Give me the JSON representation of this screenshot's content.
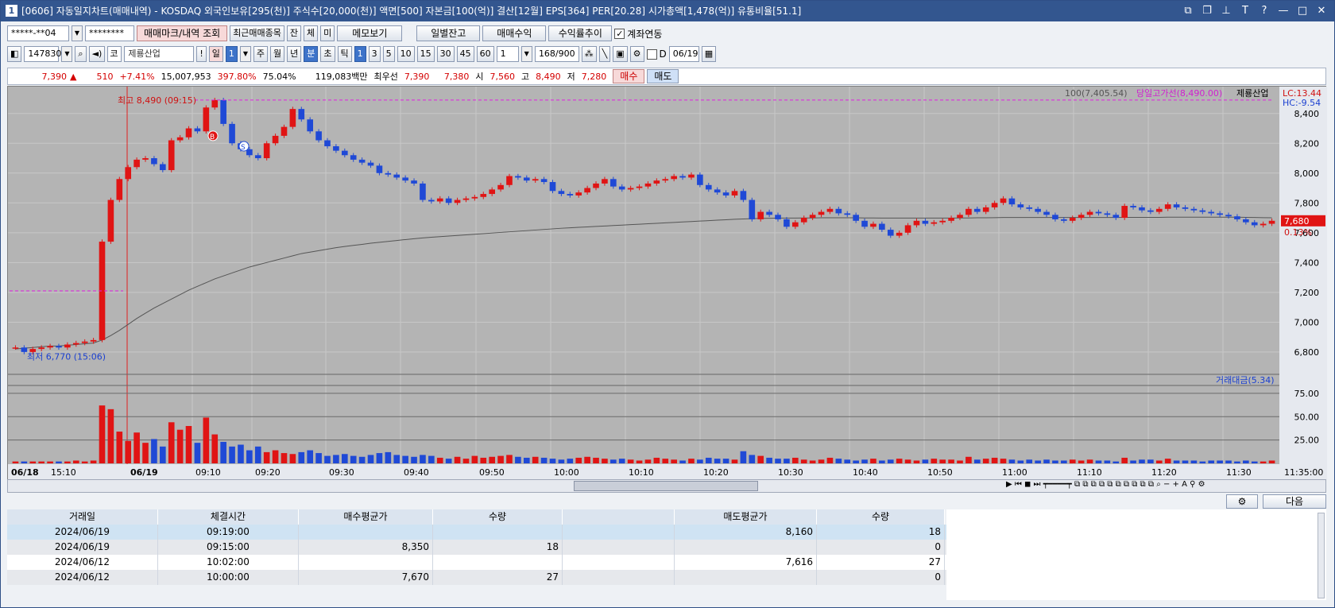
{
  "title": "[0606] 자동일지차트(매매내역) - KOSDAQ 외국인보유[295(천)] 주식수[20,000(천)] 액면[500] 자본금[100(억)] 결산[12월] EPS[364] PER[20.28] 시가총액[1,478(억)] 유통비율[51.1]",
  "window_num": "1",
  "toolbar1": {
    "account": "*****-**04",
    "password": "********",
    "btn_marks": "매매마크/내역 조회",
    "btn_recent": "최근매매종목",
    "btn_jan": "잔",
    "btn_che": "체",
    "btn_mi": "미",
    "btn_memo": "메모보기",
    "btn_daily": "일별잔고",
    "btn_profit": "매매수익",
    "btn_rate": "수익률추이",
    "link_label": "계좌연동"
  },
  "toolbar2": {
    "code": "147830",
    "market": "코",
    "name": "제룡산업",
    "ex": "!",
    "day": "일",
    "day_n": "1",
    "week": "주",
    "month": "월",
    "year": "년",
    "minute": "분",
    "sec": "초",
    "tick": "틱",
    "periods": [
      "1",
      "3",
      "5",
      "10",
      "15",
      "30",
      "45",
      "60"
    ],
    "count": "1",
    "range": "168/900",
    "d": "D",
    "date": "06/19"
  },
  "quote": {
    "price": "7,390",
    "arrow": "▲",
    "change": "510",
    "rate": "+7.41%",
    "volume": "15,007,953",
    "vol_rate": "397.80%",
    "turnover": "75.04%",
    "amount": "119,083백만",
    "best_label": "최우선",
    "ask": "7,390",
    "bid": "7,380",
    "open_l": "시",
    "open": "7,560",
    "high_l": "고",
    "high": "8,490",
    "low_l": "저",
    "low": "7,280",
    "buy": "매수",
    "sell": "매도"
  },
  "chart_data": {
    "type": "candlestick",
    "ylim": [
      6650,
      8580
    ],
    "yticks": [
      "8,400",
      "8,200",
      "8,000",
      "7,800",
      "7,600",
      "7,400",
      "7,200",
      "7,000",
      "6,800"
    ],
    "ytick_values": [
      8400,
      8200,
      8000,
      7800,
      7600,
      7400,
      7200,
      7000,
      6800
    ],
    "xlabels": [
      "06/18",
      "15:10",
      "06/19",
      "09:10",
      "09:20",
      "09:30",
      "09:40",
      "09:50",
      "10:00",
      "10:10",
      "10:20",
      "10:30",
      "10:40",
      "10:50",
      "11:00",
      "11:10",
      "11:20",
      "11:30",
      "11:35:00"
    ],
    "legend_ma": "100(7,405.54)",
    "legend_high": "당일고가선(8,490.00)",
    "legend_name": "제룡산업",
    "lc": "LC:13.44",
    "hc": "HC:-9.54",
    "last_price": "7,680",
    "last_rate": "0.13%",
    "high_note": "최고 8,490 (09:15)",
    "low_note": "최저 6,770 (15:06)",
    "mark_b": "B",
    "mark_s": "S",
    "close_series": [
      6830,
      6800,
      6820,
      6830,
      6840,
      6830,
      6850,
      6860,
      6870,
      6880,
      7540,
      7820,
      7960,
      8040,
      8090,
      8100,
      8060,
      8020,
      8220,
      8240,
      8300,
      8280,
      8440,
      8490,
      8330,
      8200,
      8160,
      8120,
      8100,
      8200,
      8250,
      8310,
      8430,
      8360,
      8280,
      8220,
      8180,
      8150,
      8120,
      8090,
      8070,
      8050,
      8000,
      7990,
      7970,
      7950,
      7930,
      7820,
      7810,
      7830,
      7800,
      7820,
      7830,
      7840,
      7860,
      7890,
      7920,
      7980,
      7970,
      7950,
      7960,
      7940,
      7880,
      7860,
      7850,
      7870,
      7900,
      7930,
      7960,
      7910,
      7890,
      7900,
      7910,
      7930,
      7950,
      7960,
      7980,
      7970,
      7990,
      7920,
      7890,
      7870,
      7850,
      7880,
      7820,
      7690,
      7740,
      7720,
      7690,
      7640,
      7670,
      7700,
      7720,
      7740,
      7760,
      7730,
      7720,
      7680,
      7640,
      7660,
      7620,
      7580,
      7600,
      7650,
      7680,
      7660,
      7670,
      7680,
      7700,
      7720,
      7760,
      7740,
      7770,
      7800,
      7830,
      7790,
      7770,
      7760,
      7740,
      7720,
      7690,
      7680,
      7700,
      7720,
      7740,
      7730,
      7720,
      7700,
      7780,
      7770,
      7750,
      7740,
      7760,
      7790,
      7770,
      7760,
      7750,
      7740,
      7730,
      7720,
      7710,
      7690,
      7670,
      7650,
      7660,
      7680
    ],
    "volume_label": "거래대금(5.34)",
    "volume_ticks": [
      "75.00",
      "50.00",
      "25.00"
    ],
    "volume_series": [
      2,
      2,
      2,
      2,
      2,
      2,
      2,
      3,
      2,
      3,
      62,
      58,
      34,
      24,
      33,
      22,
      26,
      18,
      44,
      36,
      40,
      22,
      49,
      31,
      23,
      18,
      20,
      14,
      18,
      12,
      14,
      11,
      10,
      12,
      14,
      11,
      8,
      9,
      10,
      8,
      7,
      9,
      11,
      12,
      9,
      8,
      7,
      9,
      8,
      6,
      5,
      7,
      5,
      8,
      6,
      7,
      8,
      9,
      7,
      6,
      7,
      6,
      5,
      4,
      5,
      6,
      7,
      6,
      5,
      4,
      5,
      4,
      3,
      4,
      6,
      5,
      4,
      3,
      5,
      4,
      6,
      5,
      5,
      4,
      13,
      9,
      8,
      6,
      5,
      5,
      6,
      4,
      3,
      4,
      6,
      5,
      4,
      3,
      4,
      5,
      3,
      4,
      5,
      4,
      3,
      4,
      5,
      4,
      4,
      3,
      7,
      4,
      5,
      6,
      5,
      4,
      3,
      4,
      3,
      4,
      3,
      3,
      4,
      3,
      4,
      3,
      3,
      2,
      6,
      3,
      4,
      4,
      3,
      5,
      3,
      3,
      3,
      2,
      3,
      3,
      3,
      2,
      3,
      2,
      2,
      3
    ],
    "ma_series": [
      6820,
      6825,
      6830,
      6835,
      6840,
      6840,
      6845,
      6850,
      6855,
      6860,
      6880,
      6910,
      6945,
      6985,
      7025,
      7060,
      7095,
      7125,
      7155,
      7185,
      7215,
      7240,
      7265,
      7290,
      7310,
      7330,
      7350,
      7370,
      7385,
      7400,
      7415,
      7430,
      7445,
      7460,
      7470,
      7480,
      7490,
      7500,
      7508,
      7515,
      7522,
      7530,
      7536,
      7542,
      7548,
      7554,
      7560,
      7565,
      7570,
      7574,
      7578,
      7582,
      7586,
      7590,
      7594,
      7598,
      7602,
      7606,
      7610,
      7614,
      7618,
      7622,
      7626,
      7630,
      7633,
      7636,
      7639,
      7642,
      7645,
      7648,
      7651,
      7654,
      7657,
      7660,
      7663,
      7666,
      7669,
      7672,
      7675,
      7678,
      7681,
      7684,
      7687,
      7690,
      7692,
      7694,
      7696,
      7697,
      7698,
      7698,
      7698,
      7699,
      7699,
      7700,
      7700,
      7700,
      7700,
      7700,
      7699,
      7699,
      7698,
      7698,
      7698,
      7698,
      7698,
      7698,
      7698,
      7698,
      7698,
      7699,
      7699,
      7700,
      7700,
      7701,
      7702,
      7702,
      7702,
      7702,
      7702,
      7702,
      7702,
      7702,
      7702,
      7702,
      7702,
      7702,
      7702,
      7702,
      7703,
      7703,
      7703,
      7703,
      7703,
      7704,
      7704,
      7704,
      7704,
      7704,
      7704,
      7704,
      7704,
      7704,
      7703,
      7702,
      7701,
      7700
    ]
  },
  "bottom_icons": "다음",
  "table": {
    "headers": [
      "거래일",
      "체결시간",
      "매수평균가",
      "수량",
      "",
      "매도평균가",
      "수량"
    ],
    "rows": [
      [
        "2024/06/19",
        "09:19:00",
        "",
        "",
        "",
        "8,160",
        "18"
      ],
      [
        "2024/06/19",
        "09:15:00",
        "8,350",
        "18",
        "",
        "",
        "0"
      ],
      [
        "2024/06/12",
        "10:02:00",
        "",
        "",
        "",
        "7,616",
        "27"
      ],
      [
        "2024/06/12",
        "10:00:00",
        "7,670",
        "27",
        "",
        "",
        "0"
      ]
    ]
  }
}
